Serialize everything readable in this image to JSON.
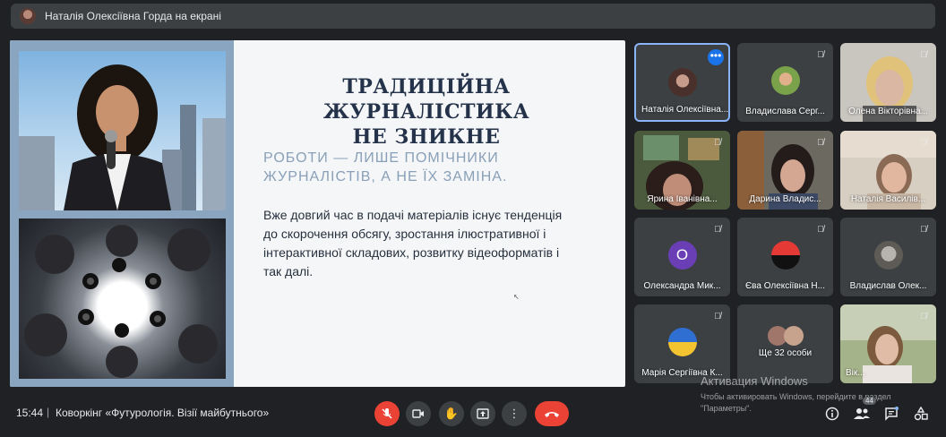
{
  "topbar": {
    "presenting": "Наталія Олексіївна Горда на екрані"
  },
  "slide": {
    "heading_line1": "ТРАДИЦІЙНА ЖУРНАЛІСТИКА",
    "heading_line2": "НЕ ЗНИКНЕ",
    "subheading": "РОБОТИ — ЛИШЕ ПОМІЧНИКИ ЖУРНАЛІСТІВ, А НЕ ЇХ ЗАМІНА.",
    "body": "Вже довгий час в подачі матеріалів існує тенденція до скорочення обсягу, зростання ілюстративної і інтерактивної складових, розвитку відеоформатів і так далі."
  },
  "participants": [
    {
      "name": "Наталія Олексіївна..."
    },
    {
      "name": "Владислава Серг..."
    },
    {
      "name": "Олена Вікторівна..."
    },
    {
      "name": "Ярина Іванівна..."
    },
    {
      "name": "Дарина Владис..."
    },
    {
      "name": "Наталія Василів..."
    },
    {
      "name": "Олександра Мик...",
      "initial": "О"
    },
    {
      "name": "Єва Олексіївна Н..."
    },
    {
      "name": "Владислав Олек..."
    },
    {
      "name": "Марія Сергіївна К..."
    },
    {
      "name": "Ще 32 особи"
    },
    {
      "name": "Вік..."
    }
  ],
  "bottombar": {
    "time": "15:44",
    "separator": "|",
    "meeting": "Коворкінг «Футурологія. Візії майбутнього»",
    "people_count": "44"
  },
  "watermark": {
    "line1": "Активация Windows",
    "line2": "Чтобы активировать Windows, перейдите в раздел \"Параметры\"."
  },
  "icons": {
    "mic_off": "mic-off-icon",
    "camera": "camera-icon",
    "hand": "raise-hand-icon",
    "present": "present-icon",
    "more": "more-vert-icon",
    "end_call": "end-call-icon",
    "info": "info-icon",
    "people": "people-icon",
    "chat": "chat-icon",
    "activities": "activities-icon"
  },
  "colors": {
    "accent": "#8ab4f8",
    "danger": "#ea4335",
    "panel": "#3c4043",
    "background": "#202124"
  }
}
